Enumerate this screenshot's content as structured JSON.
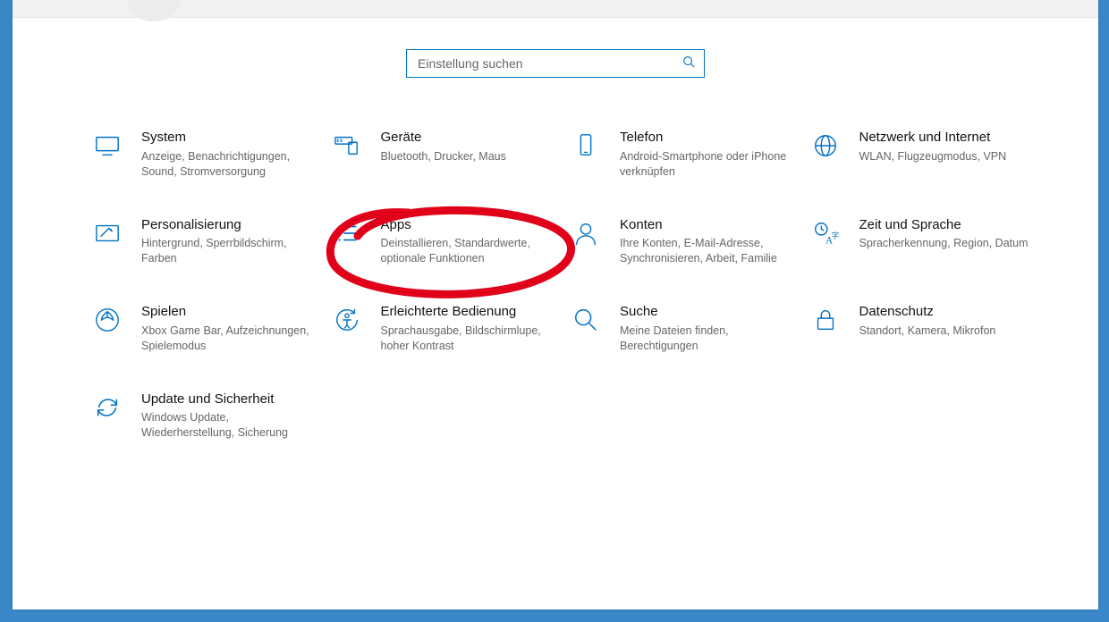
{
  "search": {
    "placeholder": "Einstellung suchen"
  },
  "tiles": [
    {
      "title": "System",
      "desc": "Anzeige, Benachrichtigungen, Sound, Stromversorgung"
    },
    {
      "title": "Geräte",
      "desc": "Bluetooth, Drucker, Maus"
    },
    {
      "title": "Telefon",
      "desc": "Android-Smartphone oder iPhone verknüpfen"
    },
    {
      "title": "Netzwerk und Internet",
      "desc": "WLAN, Flugzeugmodus, VPN"
    },
    {
      "title": "Personalisierung",
      "desc": "Hintergrund, Sperrbildschirm, Farben"
    },
    {
      "title": "Apps",
      "desc": "Deinstallieren, Standardwerte, optionale Funktionen"
    },
    {
      "title": "Konten",
      "desc": "Ihre Konten, E-Mail-Adresse, Synchronisieren, Arbeit, Familie"
    },
    {
      "title": "Zeit und Sprache",
      "desc": "Spracherkennung, Region, Datum"
    },
    {
      "title": "Spielen",
      "desc": "Xbox Game Bar, Aufzeichnungen, Spielemodus"
    },
    {
      "title": "Erleichterte Bedienung",
      "desc": "Sprachausgabe, Bildschirmlupe, hoher Kontrast"
    },
    {
      "title": "Suche",
      "desc": "Meine Dateien finden, Berechtigungen"
    },
    {
      "title": "Datenschutz",
      "desc": "Standort, Kamera, Mikrofon"
    },
    {
      "title": "Update und Sicherheit",
      "desc": "Windows Update, Wiederherstellung, Sicherung"
    }
  ],
  "annotation": {
    "target": "Apps",
    "color": "#e1001a"
  }
}
